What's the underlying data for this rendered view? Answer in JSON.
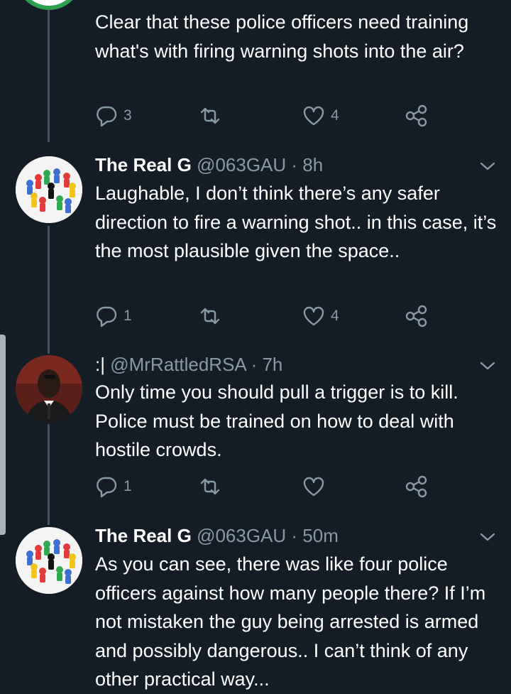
{
  "tweets": [
    {
      "body": "Clear that these police officers need training what's with firing warning shots into the air?",
      "replies": "3",
      "retweets": "",
      "likes": "4"
    },
    {
      "name": "The Real G",
      "handle": "@063GAU",
      "time": "· 8h",
      "body": "Laughable, I don’t think there’s any safer direction to fire a warning shot.. in this case, it’s the most plausible given the space..",
      "replies": "1",
      "retweets": "",
      "likes": "4",
      "avatar_icon": "game-pieces-avatar"
    },
    {
      "name": ":|",
      "handle": "@MrRattledRSA",
      "time": "· 7h",
      "body": "Only time you should pull a trigger is to kill. Police must be trained on how to deal with hostile crowds.",
      "replies": "1",
      "retweets": "",
      "likes": "",
      "avatar_icon": "man-photo-avatar"
    },
    {
      "name": "The Real G",
      "handle": "@063GAU",
      "time": "· 50m",
      "body": "As you can see, there was like four police officers against how many people there? If I’m not mistaken the guy being arrested is armed and possibly dangerous.. I can’t think of any other practical way...",
      "avatar_icon": "game-pieces-avatar"
    }
  ],
  "colors": {
    "background": "#141d26",
    "secondary_text": "#8899a6",
    "thread_line": "#3d5466"
  }
}
